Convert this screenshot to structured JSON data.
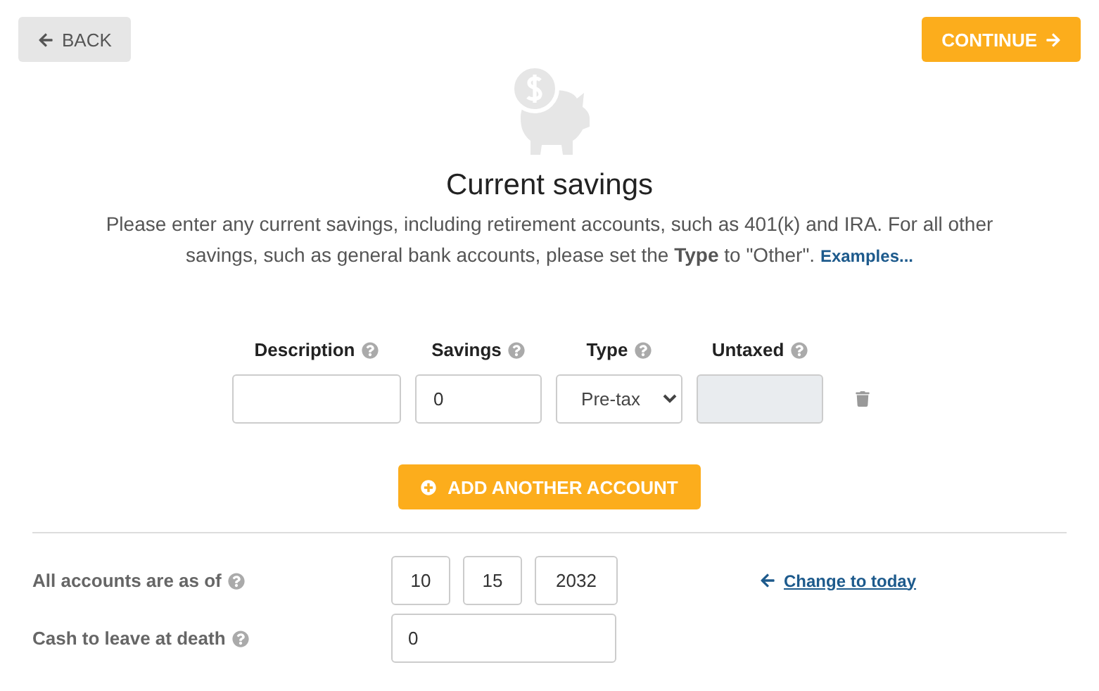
{
  "nav": {
    "back": "BACK",
    "continue": "CONTINUE"
  },
  "heading": {
    "title": "Current savings",
    "intro": "Please enter any current savings, including retirement accounts, such as 401(k) and IRA. For all other savings, such as general bank accounts, please set the **Type** to \"Other\".",
    "link": "Examples..."
  },
  "accounts": {
    "columns": [
      {
        "label": "Description"
      },
      {
        "label": "Savings"
      },
      {
        "label": "Type"
      },
      {
        "label": "Untaxed"
      }
    ],
    "rows": [
      {
        "description": "",
        "savings": "0",
        "type": "Pre-tax",
        "untaxed_disabled": true
      }
    ],
    "add_button": "ADD ANOTHER ACCOUNT"
  },
  "settings": [
    {
      "kind": "date",
      "label": "All accounts are as of",
      "help": true,
      "values": [
        "10",
        "15",
        "2032"
      ],
      "action": "Change to today"
    },
    {
      "kind": "number",
      "label": "Cash to leave at death",
      "help": true,
      "values": [
        "0"
      ]
    }
  ]
}
